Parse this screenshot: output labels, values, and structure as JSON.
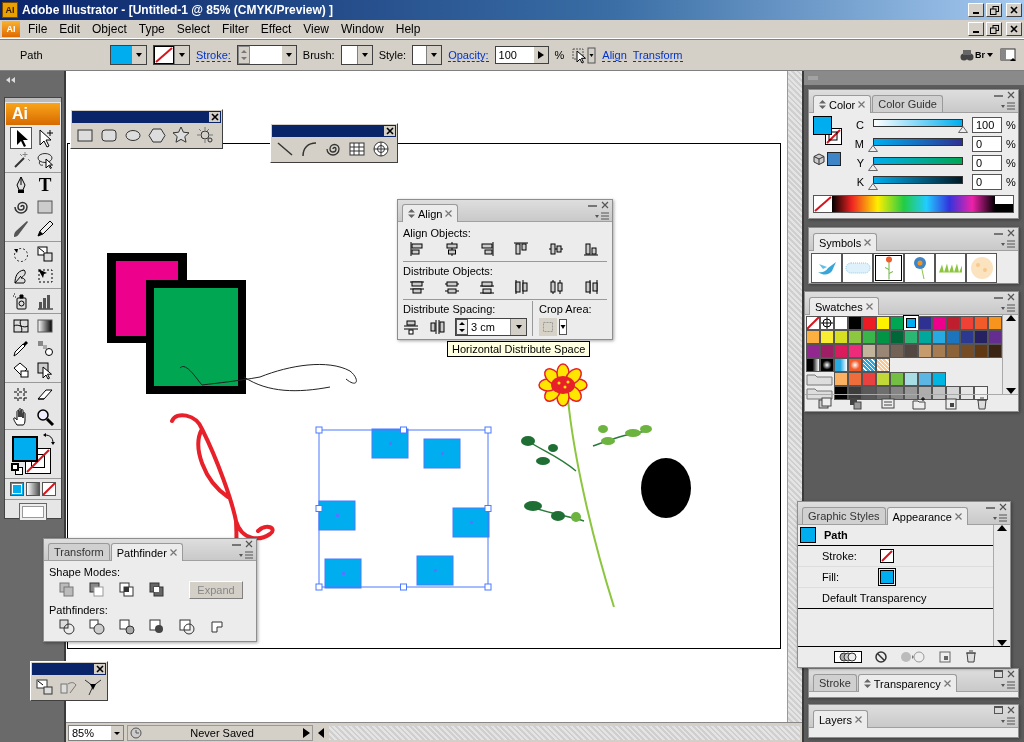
{
  "window": {
    "title": "Adobe Illustrator - [Untitled-1 @ 85% (CMYK/Preview) ]",
    "icon_text": "AI"
  },
  "menu": {
    "icon_text": "AI",
    "items": [
      {
        "label": "File"
      },
      {
        "label": "Edit"
      },
      {
        "label": "Object"
      },
      {
        "label": "Type"
      },
      {
        "label": "Select"
      },
      {
        "label": "Filter"
      },
      {
        "label": "Effect"
      },
      {
        "label": "View"
      },
      {
        "label": "Window"
      },
      {
        "label": "Help"
      }
    ]
  },
  "control_bar": {
    "selection": "Path",
    "stroke_label": "Stroke:",
    "brush_label": "Brush:",
    "style_label": "Style:",
    "opacity_label": "Opacity:",
    "opacity_value": "100",
    "percent": "%",
    "links": [
      "Align",
      "Transform"
    ],
    "bridge": "Br"
  },
  "tools": {
    "logo": "Ai",
    "groups": [
      {
        "tools": [
          {
            "kind": "select",
            "selected": true
          },
          {
            "kind": "direct",
            "selected": false
          },
          {
            "kind": "wand",
            "selected": false
          },
          {
            "kind": "lasso",
            "selected": false
          }
        ]
      },
      {
        "tools": [
          {
            "kind": "pen",
            "selected": false
          },
          {
            "kind": "type",
            "glyph": "T",
            "selected": false
          },
          {
            "kind": "spiral",
            "selected": false
          },
          {
            "kind": "rect",
            "selected": false
          },
          {
            "kind": "brush",
            "selected": false
          },
          {
            "kind": "pencil",
            "selected": false
          }
        ]
      },
      {
        "tools": [
          {
            "kind": "rotate",
            "selected": false
          },
          {
            "kind": "scale",
            "selected": false
          },
          {
            "kind": "warp",
            "selected": false
          },
          {
            "kind": "freetransform",
            "selected": false
          }
        ]
      },
      {
        "tools": [
          {
            "kind": "spray",
            "selected": false
          },
          {
            "kind": "graph",
            "selected": false
          }
        ]
      },
      {
        "tools": [
          {
            "kind": "mesh",
            "selected": false
          },
          {
            "kind": "gradient",
            "selected": false
          },
          {
            "kind": "eyedropper",
            "selected": false
          },
          {
            "kind": "blend",
            "selected": false
          },
          {
            "kind": "bucket",
            "selected": false
          },
          {
            "kind": "liveselect",
            "selected": false
          }
        ]
      },
      {
        "tools": [
          {
            "kind": "crop",
            "selected": false
          },
          {
            "kind": "eraser",
            "selected": false
          },
          {
            "kind": "hand",
            "selected": false
          },
          {
            "kind": "zoom",
            "selected": false
          }
        ]
      }
    ]
  },
  "align": {
    "tabs": [
      {
        "label": "Align",
        "selected": true,
        "toggle": true
      }
    ],
    "sections": [
      {
        "kind": "align",
        "label": "Align Objects:"
      },
      {
        "kind": "distribute",
        "label": "Distribute Objects:"
      }
    ],
    "spacing": {
      "label": "Distribute Spacing:",
      "value": "3 cm"
    },
    "crop": {
      "label": "Crop Area:"
    }
  },
  "tooltip": {
    "text": "Horizontal Distribute Space"
  },
  "pathfinder": {
    "tabs": [
      {
        "label": "Transform",
        "selected": false,
        "toggle": false
      },
      {
        "label": "Pathfinder",
        "selected": true,
        "toggle": false
      }
    ],
    "shape_modes_label": "Shape Modes:",
    "expand": {
      "label": "Expand",
      "disabled": true
    },
    "pathfinders_label": "Pathfinders:"
  },
  "color": {
    "tabs": [
      {
        "label": "Color",
        "selected": true,
        "toggle": true
      },
      {
        "label": "Color Guide",
        "selected": false,
        "toggle": false
      }
    ],
    "channels": [
      {
        "name": "C",
        "level": 1,
        "value": "100",
        "unit": "%"
      },
      {
        "name": "M",
        "level": 0,
        "value": "0",
        "unit": "%"
      },
      {
        "name": "Y",
        "level": 0,
        "value": "0",
        "unit": "%"
      },
      {
        "name": "K",
        "level": 0,
        "value": "0",
        "unit": "%"
      }
    ]
  },
  "symbols": {
    "tabs": [
      {
        "label": "Symbols",
        "selected": true,
        "toggle": false
      }
    ],
    "items": [
      {
        "kind": "bird",
        "selected": false
      },
      {
        "kind": "cloud",
        "selected": false
      },
      {
        "kind": "flower",
        "selected": true
      },
      {
        "kind": "blossom",
        "selected": false
      },
      {
        "kind": "grass",
        "selected": false
      },
      {
        "kind": "dots",
        "selected": false
      }
    ]
  },
  "swatches": {
    "tabs": [
      {
        "label": "Swatches",
        "selected": true,
        "toggle": false
      }
    ],
    "rows": [
      {
        "items": [
          {
            "kind": "none",
            "selected": false
          },
          {
            "kind": "registration",
            "selected": false
          },
          {
            "kind": "color",
            "color": "#ffffff",
            "selected": false
          },
          {
            "kind": "color",
            "color": "#000000",
            "selected": false
          },
          {
            "kind": "color",
            "color": "#ed1c24",
            "selected": false
          },
          {
            "kind": "color",
            "color": "#fff200",
            "selected": false
          },
          {
            "kind": "color",
            "color": "#00a651",
            "selected": false
          },
          {
            "kind": "color",
            "color": "#00aeef",
            "selected": true
          },
          {
            "kind": "color",
            "color": "#2e3192",
            "selected": false
          },
          {
            "kind": "color",
            "color": "#ec008c",
            "selected": false
          },
          {
            "kind": "color",
            "color": "#be1e2d",
            "selected": false
          },
          {
            "kind": "color",
            "color": "#ef4136",
            "selected": false
          },
          {
            "kind": "color",
            "color": "#f15a29",
            "selected": false
          },
          {
            "kind": "color",
            "color": "#f7941d",
            "selected": false
          }
        ]
      },
      {
        "items": [
          {
            "kind": "color",
            "color": "#fbb040",
            "selected": false
          },
          {
            "kind": "color",
            "color": "#f9ed32",
            "selected": false
          },
          {
            "kind": "color",
            "color": "#d7df23",
            "selected": false
          },
          {
            "kind": "color",
            "color": "#8dc63f",
            "selected": false
          },
          {
            "kind": "color",
            "color": "#39b54a",
            "selected": false
          },
          {
            "kind": "color",
            "color": "#009444",
            "selected": false
          },
          {
            "kind": "color",
            "color": "#006838",
            "selected": false
          },
          {
            "kind": "color",
            "color": "#2bb673",
            "selected": false
          },
          {
            "kind": "color",
            "color": "#00a79d",
            "selected": false
          },
          {
            "kind": "color",
            "color": "#27aae1",
            "selected": false
          },
          {
            "kind": "color",
            "color": "#1c75bc",
            "selected": false
          },
          {
            "kind": "color",
            "color": "#2b3990",
            "selected": false
          },
          {
            "kind": "color",
            "color": "#262262",
            "selected": false
          },
          {
            "kind": "color",
            "color": "#662d91",
            "selected": false
          }
        ]
      },
      {
        "items": [
          {
            "kind": "color",
            "color": "#92278f",
            "selected": false
          },
          {
            "kind": "color",
            "color": "#9e1f63",
            "selected": false
          },
          {
            "kind": "color",
            "color": "#da1c5c",
            "selected": false
          },
          {
            "kind": "color",
            "color": "#ee2a7b",
            "selected": false
          },
          {
            "kind": "color",
            "color": "#c2b59b",
            "selected": false
          },
          {
            "kind": "color",
            "color": "#998675",
            "selected": false
          },
          {
            "kind": "color",
            "color": "#736357",
            "selected": false
          },
          {
            "kind": "color",
            "color": "#534741",
            "selected": false
          },
          {
            "kind": "color",
            "color": "#c69c6d",
            "selected": false
          },
          {
            "kind": "color",
            "color": "#a67c52",
            "selected": false
          },
          {
            "kind": "color",
            "color": "#8c6239",
            "selected": false
          },
          {
            "kind": "color",
            "color": "#754c24",
            "selected": false
          },
          {
            "kind": "color",
            "color": "#603913",
            "selected": false
          },
          {
            "kind": "color",
            "color": "#3c2415",
            "selected": false
          }
        ]
      },
      {
        "items": [
          {
            "kind": "linear",
            "color": "#000000",
            "selected": false
          },
          {
            "kind": "radial",
            "color": "#000000",
            "selected": false
          },
          {
            "kind": "linear",
            "color": "#27aae1",
            "selected": false
          },
          {
            "kind": "radial",
            "color": "#f15a29",
            "selected": false
          },
          {
            "kind": "pattern",
            "color": "#27aae1",
            "selected": false
          },
          {
            "kind": "pattern",
            "color": "#fbc98f",
            "selected": false
          }
        ]
      },
      {
        "items": [
          {
            "kind": "folder"
          },
          {
            "kind": "color",
            "color": "#fbb161",
            "selected": false
          },
          {
            "kind": "color",
            "color": "#ef6c3b",
            "selected": false
          },
          {
            "kind": "color",
            "color": "#e8413f",
            "selected": false
          },
          {
            "kind": "color",
            "color": "#c2d839",
            "selected": false
          },
          {
            "kind": "color",
            "color": "#72bf44",
            "selected": false
          },
          {
            "kind": "color",
            "color": "#a8dde5",
            "selected": false
          },
          {
            "kind": "color",
            "color": "#5bb6e4",
            "selected": false
          },
          {
            "kind": "color",
            "color": "#00b5e2",
            "selected": false
          }
        ]
      },
      {
        "items": [
          {
            "kind": "folder"
          },
          {
            "kind": "color",
            "color": "#000000",
            "selected": false
          },
          {
            "kind": "color",
            "color": "#3d3d3d",
            "selected": false
          },
          {
            "kind": "color",
            "color": "#595959",
            "selected": false
          },
          {
            "kind": "color",
            "color": "#6e6e6e",
            "selected": false
          },
          {
            "kind": "color",
            "color": "#858585",
            "selected": false
          },
          {
            "kind": "color",
            "color": "#999999",
            "selected": false
          },
          {
            "kind": "color",
            "color": "#adadad",
            "selected": false
          },
          {
            "kind": "color",
            "color": "#c2c2c2",
            "selected": false
          },
          {
            "kind": "color",
            "color": "#d6d6d6",
            "selected": false
          },
          {
            "kind": "color",
            "color": "#e6e6e6",
            "selected": false
          },
          {
            "kind": "color",
            "color": "#f2f2f2",
            "selected": false
          }
        ]
      }
    ]
  },
  "appearance": {
    "tabs": [
      {
        "label": "Graphic Styles",
        "selected": false,
        "toggle": false
      },
      {
        "label": "Appearance",
        "selected": true,
        "toggle": false
      }
    ],
    "rows": [
      {
        "kind": "header",
        "label": "Path",
        "color": "#00aeef"
      },
      {
        "kind": "none",
        "label": "Stroke:"
      },
      {
        "kind": "attribute",
        "label": "Fill:",
        "color": "#00aeef"
      },
      {
        "kind": "plain",
        "label": "Default Transparency"
      }
    ]
  },
  "stroke_panel": {
    "collapsed": true,
    "tabs": [
      {
        "label": "Stroke",
        "selected": false,
        "toggle": false
      },
      {
        "label": "Transparency",
        "selected": true,
        "toggle": true
      }
    ]
  },
  "layers_panel": {
    "collapsed": true,
    "tabs": [
      {
        "label": "Layers",
        "selected": true,
        "toggle": false
      }
    ]
  },
  "status_bar": {
    "zoom": "85%",
    "status": "Never Saved"
  }
}
